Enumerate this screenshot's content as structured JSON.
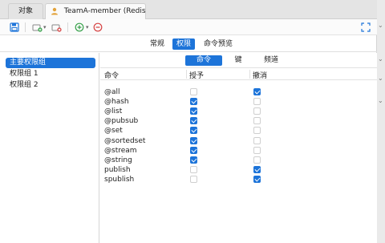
{
  "tabs": [
    {
      "label": "对象",
      "active": false
    },
    {
      "label": "TeamA-member (Redis7...",
      "active": true
    }
  ],
  "segments": [
    {
      "label": "常规",
      "active": false
    },
    {
      "label": "权限",
      "active": true
    },
    {
      "label": "命令预览",
      "active": false
    }
  ],
  "sidebar": {
    "items": [
      {
        "label": "主要权限组",
        "selected": true
      },
      {
        "label": "权限组 1",
        "selected": false
      },
      {
        "label": "权限组 2",
        "selected": false
      }
    ]
  },
  "subsegments": [
    {
      "label": "命令",
      "active": true
    },
    {
      "label": "键",
      "active": false
    },
    {
      "label": "频道",
      "active": false
    }
  ],
  "table": {
    "headers": [
      "命令",
      "授予",
      "撤消"
    ],
    "rows": [
      {
        "command": "@all",
        "grant": false,
        "revoke": true
      },
      {
        "command": "@hash",
        "grant": true,
        "revoke": false
      },
      {
        "command": "@list",
        "grant": true,
        "revoke": false
      },
      {
        "command": "@pubsub",
        "grant": true,
        "revoke": false
      },
      {
        "command": "@set",
        "grant": true,
        "revoke": false
      },
      {
        "command": "@sortedset",
        "grant": true,
        "revoke": false
      },
      {
        "command": "@stream",
        "grant": true,
        "revoke": false
      },
      {
        "command": "@string",
        "grant": true,
        "revoke": false
      },
      {
        "command": "publish",
        "grant": false,
        "revoke": true
      },
      {
        "command": "spublish",
        "grant": false,
        "revoke": true
      }
    ]
  },
  "colors": {
    "accent": "#1d74d9",
    "success": "#36a14a",
    "danger": "#d64040"
  },
  "icons": {
    "user": "user-icon",
    "save": "save-icon",
    "add_group": "add-group-icon",
    "delete_group": "delete-group-icon",
    "add": "add-circle-icon",
    "remove": "remove-circle-icon",
    "expand": "expand-icon"
  }
}
